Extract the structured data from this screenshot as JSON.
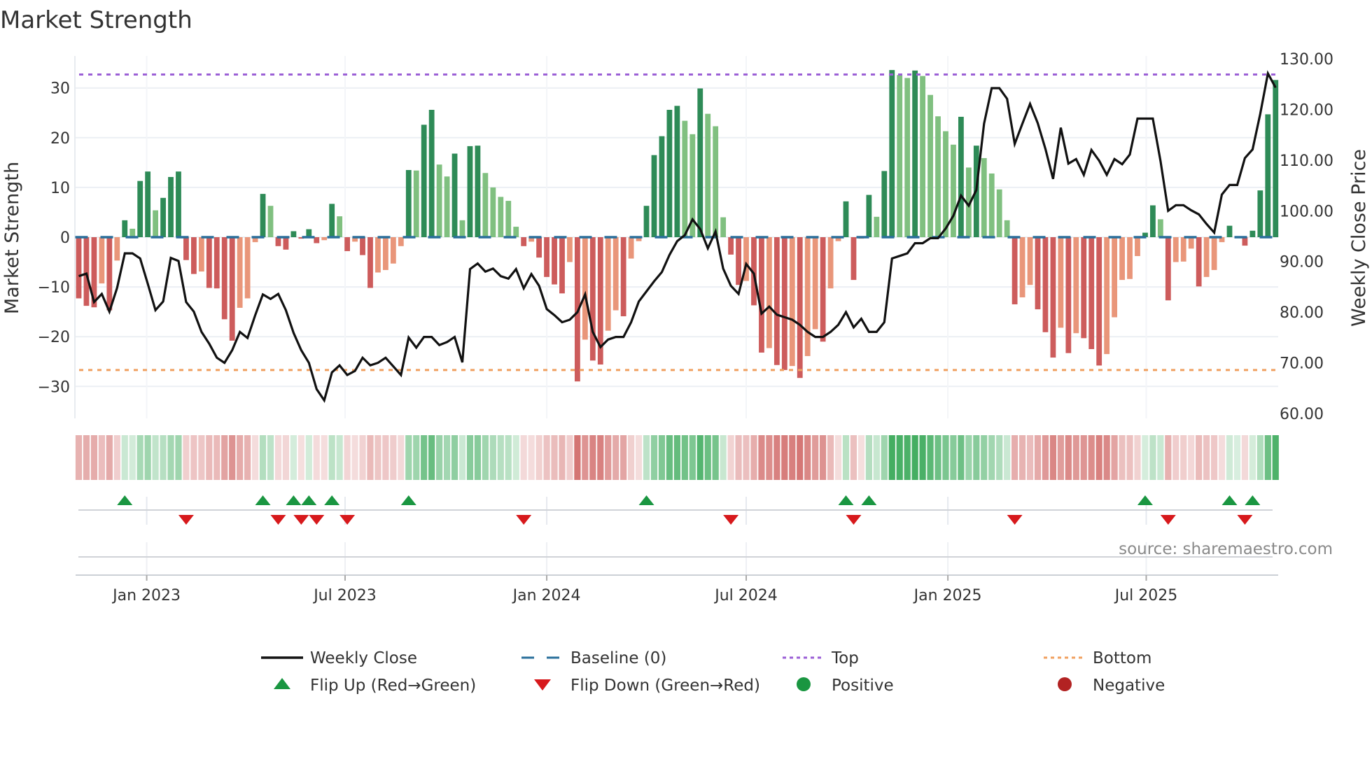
{
  "chart_data": {
    "type": "bar",
    "title": "Market Strength",
    "ylabel": "Market Strength",
    "ylabel_right": "Weekly Close Price",
    "ylim": [
      -36.4,
      36.4
    ],
    "ylim_right": [
      60,
      130
    ],
    "frequency": "weekly",
    "start_date": "2022-10-31",
    "y_ticks": [
      {
        "v": 30,
        "label": "30"
      },
      {
        "v": 20,
        "label": "20"
      },
      {
        "v": 10,
        "label": "10"
      },
      {
        "v": 0,
        "label": "0"
      },
      {
        "v": -10,
        "label": "−10"
      },
      {
        "v": -20,
        "label": "−20"
      },
      {
        "v": -30,
        "label": "−30"
      }
    ],
    "y_ticks_right": [
      {
        "v": 130,
        "label": "130.00"
      },
      {
        "v": 120,
        "label": "120.00"
      },
      {
        "v": 110,
        "label": "110.00"
      },
      {
        "v": 100,
        "label": "100.00"
      },
      {
        "v": 90,
        "label": "90.00"
      },
      {
        "v": 80,
        "label": "80.00"
      },
      {
        "v": 70,
        "label": "70.00"
      },
      {
        "v": 60,
        "label": "60.00"
      }
    ],
    "x_ticks": [
      {
        "date": "2023-01-01",
        "label": "Jan 2023"
      },
      {
        "date": "2023-07-01",
        "label": "Jul 2023"
      },
      {
        "date": "2024-01-01",
        "label": "Jan 2024"
      },
      {
        "date": "2024-07-01",
        "label": "Jul 2024"
      },
      {
        "date": "2025-01-01",
        "label": "Jan 2025"
      },
      {
        "date": "2025-07-01",
        "label": "Jul 2025"
      }
    ],
    "top_level": 32.7,
    "bottom_level": -26.7,
    "baseline": 0,
    "strength": [
      -12.3,
      -13.8,
      -14.1,
      -9.3,
      -14.7,
      -4.7,
      3.4,
      1.7,
      11.3,
      13.2,
      5.4,
      7.9,
      12.1,
      13.2,
      -4.6,
      -7.4,
      -6.9,
      -10.2,
      -10.3,
      -16.5,
      -20.8,
      -14.2,
      -12.3,
      -1.0,
      8.7,
      6.3,
      -1.8,
      -2.5,
      1.2,
      -0.3,
      1.6,
      -1.2,
      -0.6,
      6.7,
      4.2,
      -2.8,
      -0.9,
      -3.6,
      -10.2,
      -7.1,
      -6.6,
      -5.3,
      -1.8,
      13.5,
      13.4,
      22.6,
      25.6,
      14.6,
      12.2,
      16.8,
      3.4,
      18.3,
      18.4,
      12.9,
      10.0,
      8.1,
      7.3,
      2.1,
      -1.8,
      -0.9,
      -4.1,
      -8.0,
      -9.5,
      -11.3,
      -5.0,
      -29.0,
      -20.6,
      -24.8,
      -25.6,
      -18.8,
      -14.7,
      -15.9,
      -4.3,
      -0.8,
      6.3,
      16.5,
      20.3,
      25.6,
      26.4,
      23.4,
      20.7,
      29.9,
      24.8,
      22.3,
      4.0,
      -3.5,
      -9.6,
      -8.8,
      -13.7,
      -23.2,
      -22.3,
      -25.7,
      -26.7,
      -25.9,
      -28.3,
      -23.9,
      -18.5,
      -21.0,
      -10.3,
      -0.8,
      7.2,
      -8.6,
      -0.3,
      8.5,
      4.1,
      13.3,
      33.6,
      32.6,
      32.0,
      33.5,
      32.4,
      28.6,
      24.3,
      21.3,
      18.6,
      24.2,
      14.0,
      18.4,
      15.9,
      12.8,
      9.6,
      3.4,
      -13.5,
      -12.1,
      -9.6,
      -14.5,
      -19.1,
      -24.2,
      -18.2,
      -23.3,
      -19.3,
      -20.3,
      -22.5,
      -25.8,
      -23.5,
      -16.1,
      -8.6,
      -8.4,
      -3.8,
      0.9,
      6.4,
      3.6,
      -12.7,
      -5.0,
      -4.9,
      -2.3,
      -9.9,
      -8.0,
      -6.6,
      -1.0,
      2.3,
      0.2,
      -1.7,
      1.3,
      9.4,
      24.7,
      31.6
    ],
    "weekly_close": [
      87.1,
      87.6,
      82.0,
      83.6,
      80.1,
      84.8,
      91.6,
      91.6,
      90.6,
      85.6,
      80.4,
      82.1,
      90.7,
      90.1,
      82.0,
      80.1,
      76.1,
      73.8,
      71.0,
      70.0,
      72.5,
      76.1,
      74.9,
      79.4,
      83.5,
      82.6,
      83.6,
      80.4,
      75.9,
      72.5,
      70.0,
      64.8,
      62.6,
      68.1,
      69.5,
      67.6,
      68.4,
      71.0,
      69.5,
      70.0,
      71.0,
      69.3,
      67.6,
      75.0,
      73.0,
      75.1,
      75.1,
      73.5,
      74.1,
      75.1,
      70.1,
      88.5,
      89.6,
      88.0,
      88.6,
      87.1,
      86.6,
      88.5,
      84.7,
      87.5,
      85.2,
      80.6,
      79.4,
      78.0,
      78.5,
      80.0,
      83.5,
      76.1,
      73.1,
      74.6,
      75.1,
      75.1,
      78.0,
      82.1,
      84.1,
      86.1,
      87.9,
      91.3,
      94.0,
      95.2,
      98.3,
      96.4,
      92.6,
      95.9,
      88.6,
      85.2,
      83.6,
      89.5,
      87.6,
      79.7,
      81.1,
      79.5,
      79.0,
      78.5,
      77.5,
      76.1,
      75.1,
      75.1,
      76.1,
      77.5,
      80.0,
      77.0,
      78.7,
      76.1,
      76.1,
      78.0,
      90.6,
      91.1,
      91.6,
      93.6,
      93.6,
      94.6,
      94.6,
      96.5,
      99.0,
      103.0,
      101.0,
      104.1,
      117.2,
      124.2,
      124.2,
      122.1,
      113.2,
      117.2,
      121.1,
      117.3,
      112.2,
      106.3,
      116.4,
      109.3,
      110.2,
      107.1,
      112.0,
      109.9,
      107.1,
      110.2,
      109.2,
      111.1,
      118.2,
      118.2,
      118.2,
      109.8,
      100.0,
      101.1,
      101.1,
      100.1,
      99.3,
      97.4,
      95.7,
      103.2,
      105.1,
      105.1,
      110.4,
      112.1,
      119.1,
      127.1,
      124.3
    ],
    "legend": {
      "placement": "bottom",
      "items": [
        {
          "key": "close",
          "label": "Weekly Close"
        },
        {
          "key": "baseline",
          "label": "Baseline (0)"
        },
        {
          "key": "top",
          "label": "Top"
        },
        {
          "key": "bottom",
          "label": "Bottom"
        },
        {
          "key": "flip_up",
          "label": "Flip Up (Red→Green)"
        },
        {
          "key": "flip_down",
          "label": "Flip Down (Green→Red)"
        },
        {
          "key": "positive",
          "label": "Positive"
        },
        {
          "key": "negative",
          "label": "Negative"
        }
      ]
    },
    "source": "source: sharemaestro.com",
    "colors": {
      "pos_strong": "#2e8b57",
      "pos_weak": "#80c080",
      "neg_strong": "#cd5c5c",
      "neg_weak": "#e9967a",
      "close": "#111111",
      "baseline": "#2a6f9b",
      "top": "#9b5fd6",
      "bottom": "#f0a060",
      "flip_up": "#1a9641",
      "flip_down": "#d7191c",
      "positive": "#1a9641",
      "negative": "#b22222",
      "strip_pos": "#2ea44f",
      "strip_neg": "#c9514f"
    }
  }
}
